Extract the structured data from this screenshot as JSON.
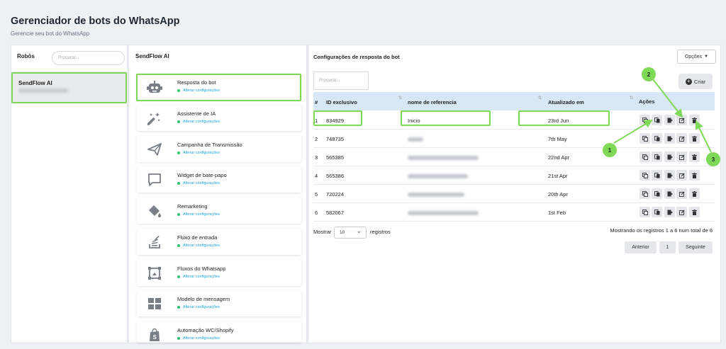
{
  "header": {
    "title": "Gerenciador de bots do WhatsApp",
    "subtitle": "Gerencie seu bot do WhatsApp"
  },
  "left_panel": {
    "title": "Robôs",
    "search_placeholder": "Procurar...",
    "bot": {
      "name": "SendFlow AI"
    }
  },
  "middle_panel": {
    "title": "SendFlow AI",
    "cards": [
      {
        "title": "Resposta do bot",
        "sub": "Alterar configurações",
        "icon": "robot-icon"
      },
      {
        "title": "Assistente de IA",
        "sub": "Alterar configurações",
        "icon": "magic-wand-icon"
      },
      {
        "title": "Campanha de Transmissão",
        "sub": "Alterar configurações",
        "icon": "paper-plane-icon"
      },
      {
        "title": "Widget de bate-papo",
        "sub": "Alterar configurações",
        "icon": "chat-bubble-icon"
      },
      {
        "title": "Remarketing",
        "sub": "Alterar configurações",
        "icon": "paint-bucket-icon"
      },
      {
        "title": "Fluxo de entrada",
        "sub": "Alterar configurações",
        "icon": "stack-icon"
      },
      {
        "title": "Fluxos do Whatsapp",
        "sub": "Alterar configurações",
        "icon": "flow-frame-icon"
      },
      {
        "title": "Modelo de mensagem",
        "sub": "Alterar configurações",
        "icon": "grid-icon"
      },
      {
        "title": "Automação WC/Shopify",
        "sub": "Alterar configurações",
        "icon": "shopify-icon"
      }
    ]
  },
  "right_panel": {
    "title": "Configurações de resposta do bot",
    "options_button": "Opções",
    "create_button": "Criar",
    "search_placeholder": "Procurar...",
    "columns": [
      "#",
      "ID exclusivo",
      "nome de referencia",
      "Atualizado em",
      "Ações"
    ],
    "rows": [
      {
        "n": "1",
        "id": "834929",
        "name": "Inicio",
        "updated": "23rd Jun"
      },
      {
        "n": "2",
        "id": "748735",
        "name": "",
        "updated": "7th May"
      },
      {
        "n": "3",
        "id": "565385",
        "name": "",
        "updated": "22nd Apr"
      },
      {
        "n": "4",
        "id": "565386",
        "name": "",
        "updated": "21st Apr"
      },
      {
        "n": "5",
        "id": "720224",
        "name": "",
        "updated": "20th Apr"
      },
      {
        "n": "6",
        "id": "582067",
        "name": "",
        "updated": "1st Feb"
      }
    ],
    "show_label": "Mostrar",
    "page_length": "10",
    "records_label": "registros",
    "info": "Mostrando os registros 1 a 6 num total de 6",
    "pagination": {
      "prev": "Anterior",
      "page": "1",
      "next": "Seguinte"
    }
  },
  "callouts": [
    "1",
    "2",
    "3"
  ],
  "colors": {
    "highlight": "#7ed957",
    "table_header": "#d8e7f5",
    "link": "#1aa3e0",
    "status_dot": "#2dc76d"
  }
}
